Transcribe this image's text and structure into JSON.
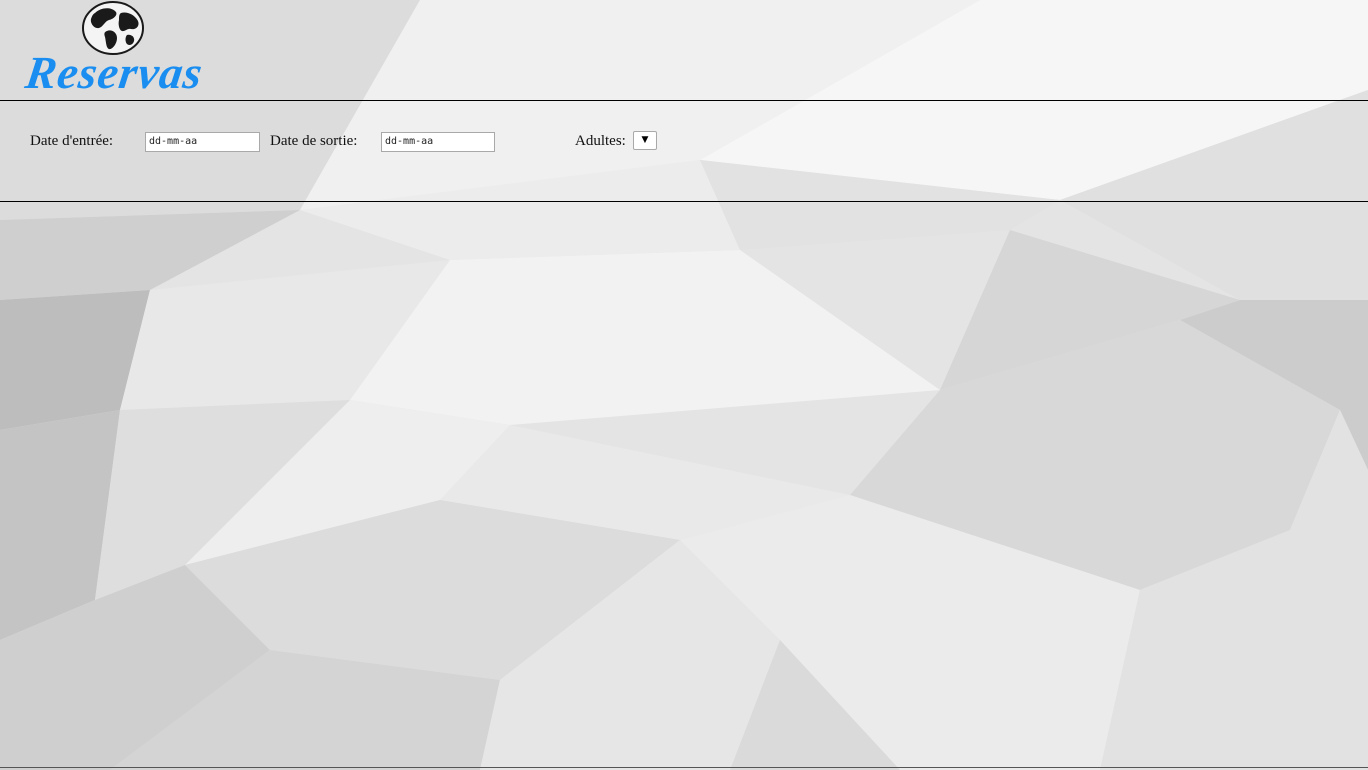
{
  "brand": {
    "name": "Reservas",
    "color": "#1a8ef0",
    "icon": "globe-icon"
  },
  "search": {
    "checkin_label": "Date d'entrée:",
    "checkin_placeholder": "dd-mm-aa",
    "checkout_label": "Date de sortie:",
    "checkout_placeholder": "dd-mm-aa",
    "adults_label": "Adultes:",
    "adults_dropdown_icon": "chevron-down-icon",
    "adults_arrow": "▼"
  }
}
